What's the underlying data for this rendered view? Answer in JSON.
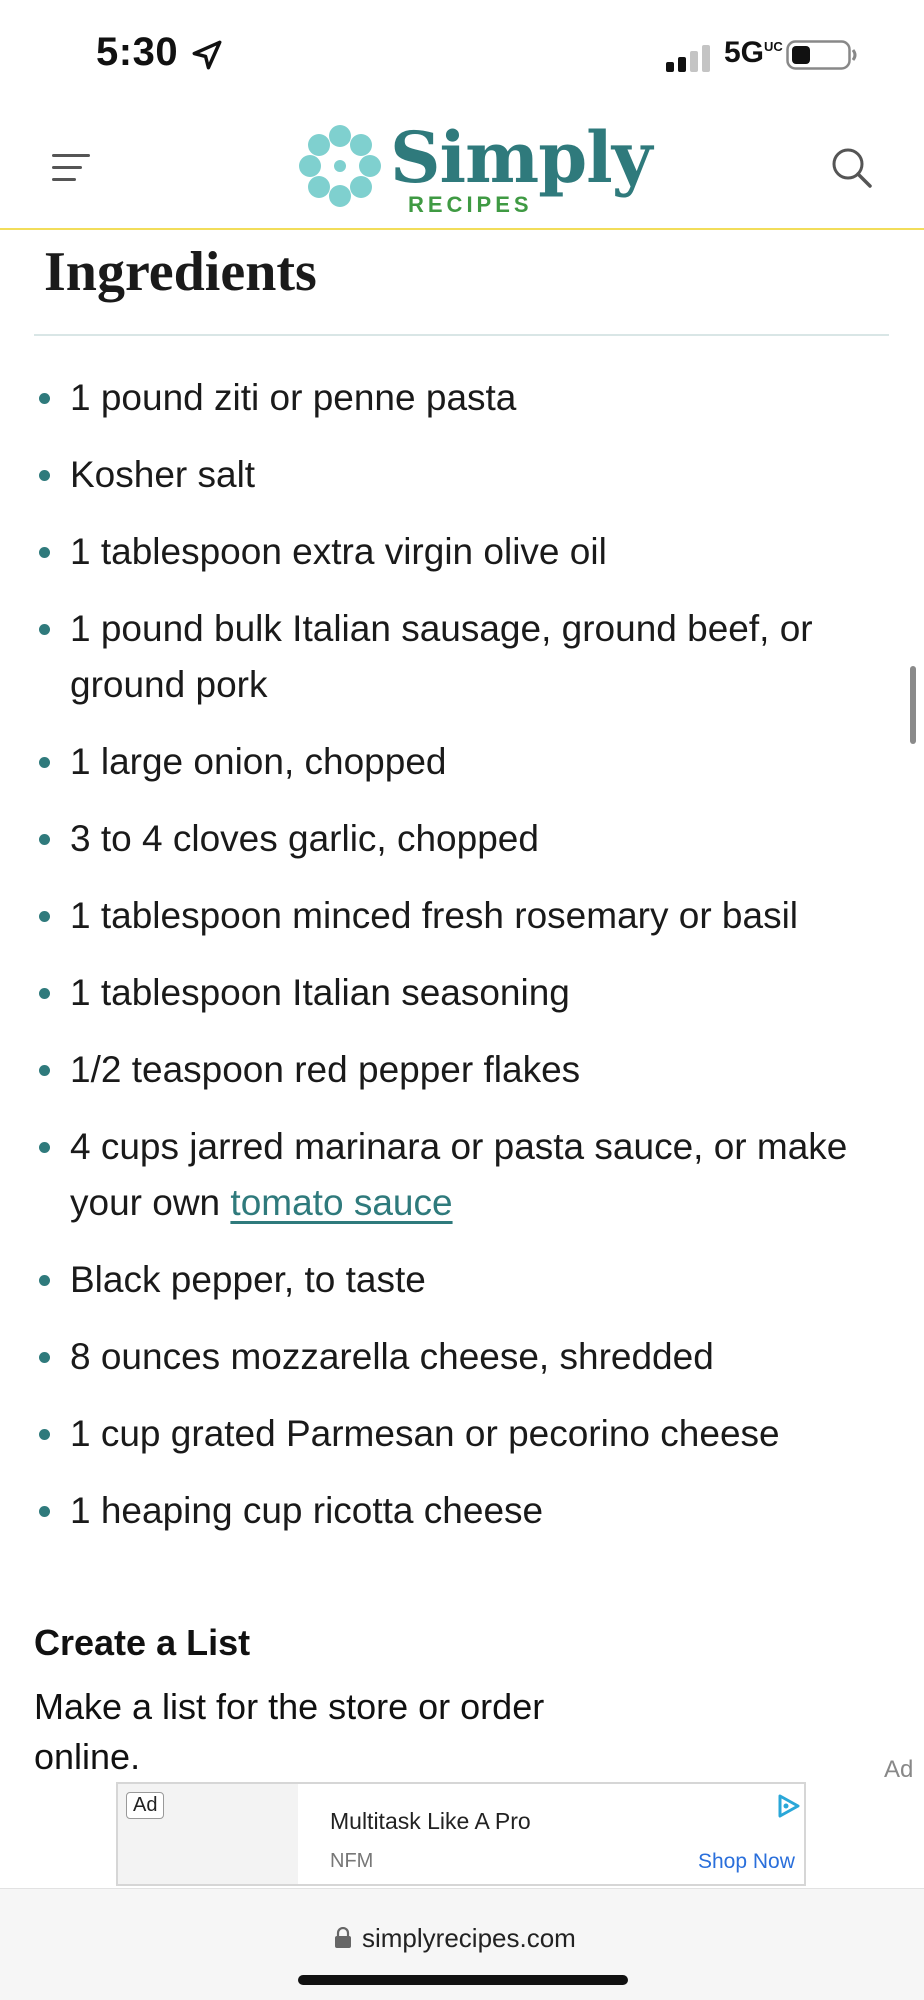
{
  "status_bar": {
    "time": "5:30",
    "network": "5G",
    "network_sup": "UC"
  },
  "header": {
    "logo_word": "Simply",
    "logo_sub": "RECIPES",
    "brand_color": "#2f7a7c",
    "accent_color": "#3f9a43"
  },
  "ingredients": {
    "title": "Ingredients",
    "items": [
      "1 pound ziti or penne pasta",
      "Kosher salt",
      "1 tablespoon extra virgin olive oil",
      "1 pound bulk Italian sausage, ground beef, or ground pork",
      "1 large onion, chopped",
      "3 to 4 cloves garlic, chopped",
      "1 tablespoon minced fresh rosemary or basil",
      "1 tablespoon Italian seasoning",
      "1/2 teaspoon red pepper flakes",
      "4 cups jarred marinara or pasta sauce, or make your own ",
      "Black pepper, to taste",
      "8 ounces mozzarella cheese, shredded",
      "1 cup grated Parmesan or pecorino cheese",
      "1 heaping cup ricotta cheese"
    ],
    "sauce_link": "tomato sauce"
  },
  "create_list": {
    "title": "Create a List",
    "description": "Make a list for the store or order online."
  },
  "ad": {
    "side_label": "Ad",
    "badge": "Ad",
    "headline": "Multitask Like A Pro",
    "advertiser": "NFM",
    "cta": "Shop Now"
  },
  "browser": {
    "url": "simplyrecipes.com"
  }
}
